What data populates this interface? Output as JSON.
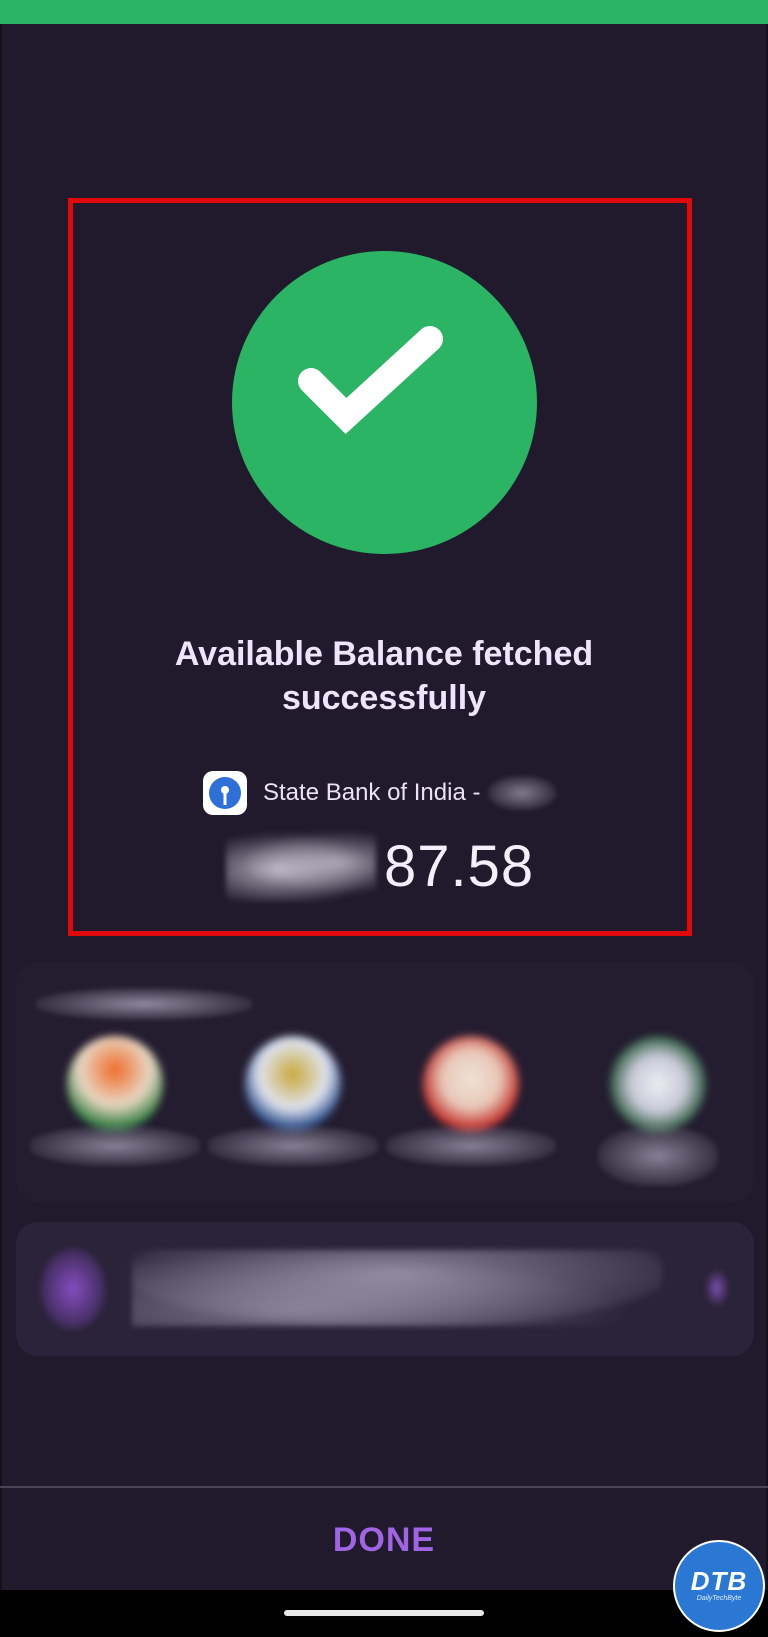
{
  "status": {
    "headline": "Available Balance fetched successfully",
    "success_color": "#2ab463"
  },
  "account": {
    "bank_name": "State Bank of India -",
    "bank_logo_icon": "sbi-logo-icon",
    "account_number_masked": true
  },
  "balance": {
    "visible_amount": "87.58",
    "prefix_masked": true
  },
  "quick_links": {
    "heading_masked": true,
    "items": [
      {
        "icon": "blurred-icon",
        "colors": [
          "#f06c2a",
          "#c8b03a"
        ]
      },
      {
        "icon": "blurred-icon",
        "colors": [
          "#3a5fa8",
          "#c9a83a"
        ]
      },
      {
        "icon": "blurred-icon",
        "colors": [
          "#d3382e",
          "#e8d6c8"
        ]
      },
      {
        "icon": "blurred-icon",
        "colors": [
          "#2c6e44",
          "#e6e6ee"
        ]
      }
    ]
  },
  "promo": {
    "icon": "blurred-purple-icon",
    "text_masked": true
  },
  "footer": {
    "done_label": "DONE",
    "done_color": "#a064e4"
  },
  "watermark": {
    "main": "DTB",
    "sub": "DailyTechByte"
  },
  "highlight_color": "#e10909"
}
